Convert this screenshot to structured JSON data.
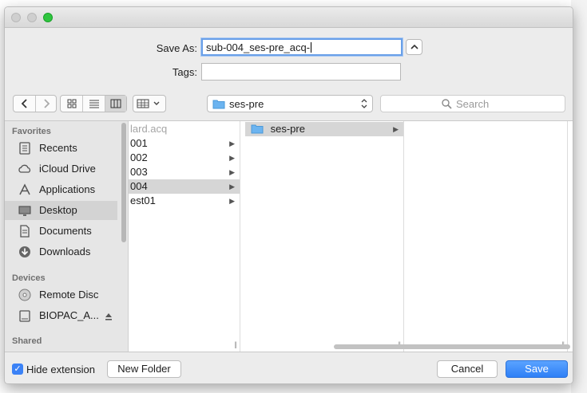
{
  "dialog": {
    "save_as_label": "Save As:",
    "save_as_value": "sub-004_ses-pre_acq-",
    "tags_label": "Tags:",
    "tags_value": ""
  },
  "toolbar": {
    "location": "ses-pre",
    "search_placeholder": "Search"
  },
  "sidebar": {
    "favorites_header": "Favorites",
    "favorites": [
      {
        "label": "Recents",
        "icon": "recents-icon"
      },
      {
        "label": "iCloud Drive",
        "icon": "icloud-icon"
      },
      {
        "label": "Applications",
        "icon": "applications-icon"
      },
      {
        "label": "Desktop",
        "icon": "desktop-icon"
      },
      {
        "label": "Documents",
        "icon": "documents-icon"
      },
      {
        "label": "Downloads",
        "icon": "downloads-icon"
      }
    ],
    "devices_header": "Devices",
    "devices": [
      {
        "label": "Remote Disc",
        "icon": "disc-icon"
      },
      {
        "label": "BIOPAC_A...",
        "icon": "drive-icon"
      }
    ],
    "shared_header": "Shared"
  },
  "columns": {
    "col1": [
      "lard.acq",
      "001",
      "002",
      "003",
      "004",
      "est01"
    ],
    "col2": [
      "ses-pre"
    ]
  },
  "footer": {
    "hide_extension_label": "Hide extension",
    "new_folder_label": "New Folder",
    "cancel_label": "Cancel",
    "save_label": "Save"
  },
  "colors": {
    "accent": "#2e7ff6",
    "folder": "#6cb4f0",
    "selection": "#d6d6d6"
  }
}
